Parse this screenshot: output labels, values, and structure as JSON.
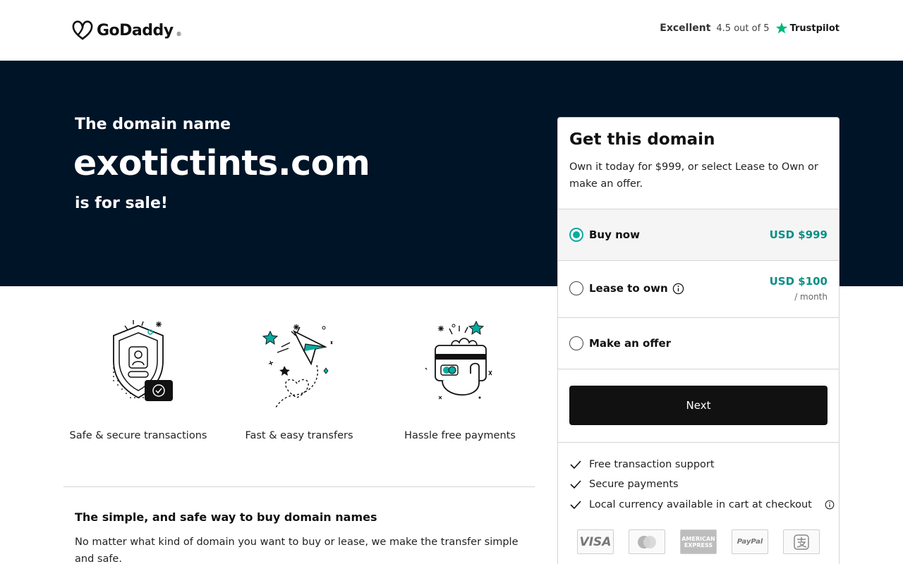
{
  "header": {
    "brand": "GoDaddy",
    "trustpilot": {
      "rating_word": "Excellent",
      "score_text": "4.5 out of 5",
      "brand": "Trustpilot"
    }
  },
  "hero": {
    "pre_title": "The domain name",
    "domain": "exotictints.com",
    "post_title": "is for sale!"
  },
  "features": [
    {
      "label": "Safe & secure transactions",
      "icon": "shield-icon"
    },
    {
      "label": "Fast & easy transfers",
      "icon": "paper-plane-icon"
    },
    {
      "label": "Hassle free payments",
      "icon": "credit-card-hand-icon"
    }
  ],
  "info": {
    "title": "The simple, and safe way to buy domain names",
    "text": "No matter what kind of domain you want to buy or lease, we make the transfer simple and safe."
  },
  "card": {
    "title": "Get this domain",
    "subtitle": "Own it today for $999, or select Lease to Own or make an offer.",
    "options": [
      {
        "label": "Buy now",
        "price": "USD $999",
        "selected": true
      },
      {
        "label": "Lease to own",
        "price": "USD $100",
        "unit": "/ month",
        "selected": false
      },
      {
        "label": "Make an offer",
        "selected": false
      }
    ],
    "next_label": "Next",
    "benefits": [
      "Free transaction support",
      "Secure payments",
      "Local currency available in cart at checkout"
    ],
    "payment_methods": [
      "VISA",
      "Mastercard",
      "AMERICAN EXPRESS",
      "PayPal",
      "Alipay"
    ]
  },
  "colors": {
    "hero_bg": "#001428",
    "accent": "#09aaa0",
    "price": "#0a8f85",
    "button_bg": "#111111"
  }
}
